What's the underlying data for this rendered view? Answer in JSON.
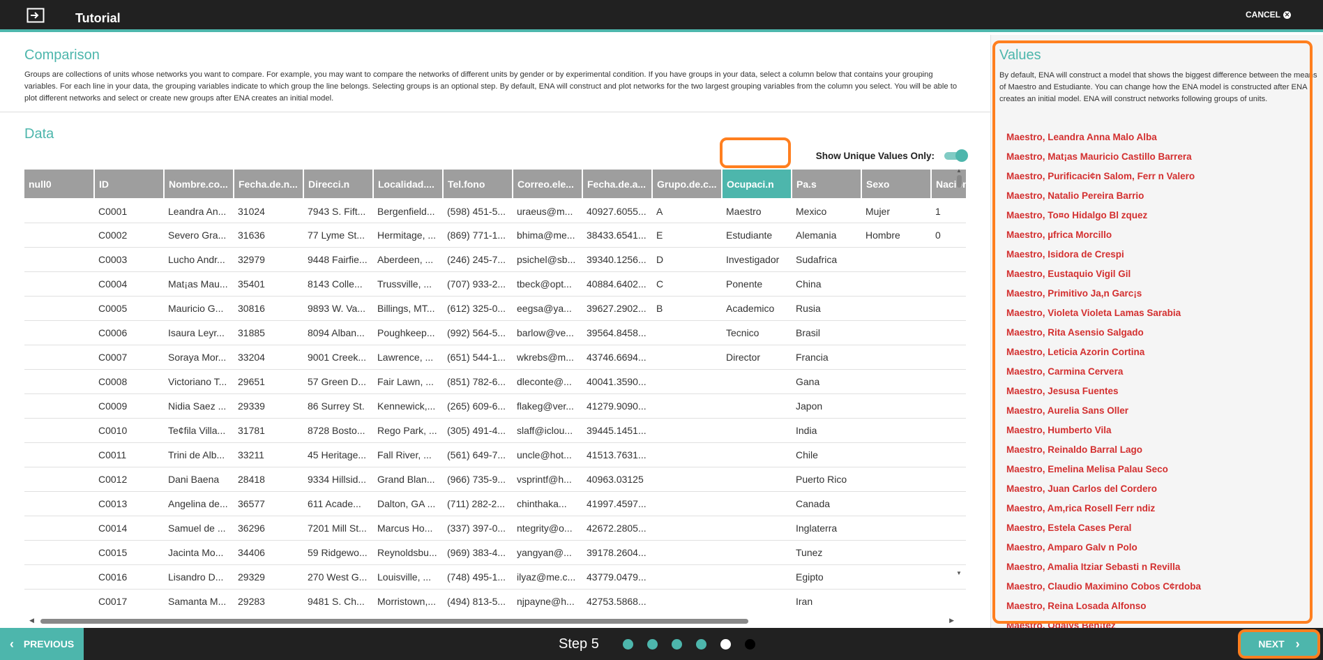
{
  "header": {
    "title": "Tutorial",
    "cancel_label": "CANCEL"
  },
  "comparison": {
    "title": "Comparison",
    "description": "Groups are collections of units whose networks you want to compare. For example, you may want to compare the networks of different units by gender or by experimental condition. If you have groups in your data, select a column below that contains your grouping variables. For each line in your data, the grouping variables indicate to which group the line belongs. Selecting groups is an optional step. By default, ENA will construct and plot networks for the two largest grouping variables from the column you select. You will be able to plot different networks and select or create new groups after ENA creates an initial model."
  },
  "data_section": {
    "title": "Data",
    "unique_toggle_label": "Show Unique Values Only:",
    "unique_toggle_on": true
  },
  "table": {
    "columns": [
      "null0",
      "ID",
      "Nombre.co...",
      "Fecha.de.n...",
      "Direcci.n",
      "Localidad....",
      "Tel.fono",
      "Correo.ele...",
      "Fecha.de.a...",
      "Grupo.de.c...",
      "Ocupaci.n",
      "Pa.s",
      "Sexo",
      "Nacion"
    ],
    "highlighted_column": "Ocupaci.n",
    "rows": [
      [
        "",
        "C0001",
        "Leandra An...",
        "31024",
        "7943 S. Fift...",
        "Bergenfield...",
        "(598) 451-5...",
        "uraeus@m...",
        "40927.6055...",
        "A",
        "Maestro",
        "Mexico",
        "Mujer",
        "1"
      ],
      [
        "",
        "C0002",
        "Severo Gra...",
        "31636",
        "77 Lyme St...",
        "Hermitage, ...",
        "(869) 771-1...",
        "bhima@me...",
        "38433.6541...",
        "E",
        "Estudiante",
        "Alemania",
        "Hombre",
        "0"
      ],
      [
        "",
        "C0003",
        "Lucho Andr...",
        "32979",
        "9448 Fairfie...",
        "Aberdeen, ...",
        "(246) 245-7...",
        "psichel@sb...",
        "39340.1256...",
        "D",
        "Investigador",
        "Sudafrica",
        "",
        ""
      ],
      [
        "",
        "C0004",
        "Mat¡as Mau...",
        "35401",
        "8143 Colle...",
        "Trussville, ...",
        "(707) 933-2...",
        "tbeck@opt...",
        "40884.6402...",
        "C",
        "Ponente",
        "China",
        "",
        ""
      ],
      [
        "",
        "C0005",
        "Mauricio G...",
        "30816",
        "9893 W. Va...",
        "Billings, MT...",
        "(612) 325-0...",
        "eegsa@ya...",
        "39627.2902...",
        "B",
        "Academico",
        "Rusia",
        "",
        ""
      ],
      [
        "",
        "C0006",
        "Isaura Leyr...",
        "31885",
        "8094 Alban...",
        "Poughkeep...",
        "(992) 564-5...",
        "barlow@ve...",
        "39564.8458...",
        "",
        "Tecnico",
        "Brasil",
        "",
        ""
      ],
      [
        "",
        "C0007",
        "Soraya Mor...",
        "33204",
        "9001 Creek...",
        "Lawrence, ...",
        "(651) 544-1...",
        "wkrebs@m...",
        "43746.6694...",
        "",
        "Director",
        "Francia",
        "",
        ""
      ],
      [
        "",
        "C0008",
        "Victoriano T...",
        "29651",
        "57 Green D...",
        "Fair Lawn, ...",
        "(851) 782-6...",
        "dleconte@...",
        "40041.3590...",
        "",
        "",
        "Gana",
        "",
        ""
      ],
      [
        "",
        "C0009",
        "Nidia Saez ...",
        "29339",
        "86 Surrey St.",
        "Kennewick,...",
        "(265) 609-6...",
        "flakeg@ver...",
        "41279.9090...",
        "",
        "",
        "Japon",
        "",
        ""
      ],
      [
        "",
        "C0010",
        "Te¢fila Villa...",
        "31781",
        "8728 Bosto...",
        "Rego Park, ...",
        "(305) 491-4...",
        "slaff@iclou...",
        "39445.1451...",
        "",
        "",
        "India",
        "",
        ""
      ],
      [
        "",
        "C0011",
        "Trini de Alb...",
        "33211",
        "45 Heritage...",
        "Fall River, ...",
        "(561) 649-7...",
        "uncle@hot...",
        "41513.7631...",
        "",
        "",
        "Chile",
        "",
        ""
      ],
      [
        "",
        "C0012",
        "Dani Baena",
        "28418",
        "9334 Hillsid...",
        "Grand Blan...",
        "(966) 735-9...",
        "vsprintf@h...",
        "40963.03125",
        "",
        "",
        "Puerto Rico",
        "",
        ""
      ],
      [
        "",
        "C0013",
        "Angelina de...",
        "36577",
        "611 Acade...",
        "Dalton, GA ...",
        "(711) 282-2...",
        "chinthaka...",
        "41997.4597...",
        "",
        "",
        "Canada",
        "",
        ""
      ],
      [
        "",
        "C0014",
        "Samuel de ...",
        "36296",
        "7201 Mill St...",
        "Marcus Ho...",
        "(337) 397-0...",
        "ntegrity@o...",
        "42672.2805...",
        "",
        "",
        "Inglaterra",
        "",
        ""
      ],
      [
        "",
        "C0015",
        "Jacinta Mo...",
        "34406",
        "59 Ridgewo...",
        "Reynoldsbu...",
        "(969) 383-4...",
        "yangyan@...",
        "39178.2604...",
        "",
        "",
        "Tunez",
        "",
        ""
      ],
      [
        "",
        "C0016",
        "Lisandro D...",
        "29329",
        "270 West G...",
        "Louisville, ...",
        "(748) 495-1...",
        "ilyaz@me.c...",
        "43779.0479...",
        "",
        "",
        "Egipto",
        "",
        ""
      ],
      [
        "",
        "C0017",
        "Samanta M...",
        "29283",
        "9481 S. Ch...",
        "Morristown,...",
        "(494) 813-5...",
        "njpayne@h...",
        "42753.5868...",
        "",
        "",
        "Iran",
        "",
        ""
      ]
    ]
  },
  "values_panel": {
    "title": "Values",
    "description": "By default, ENA will construct a model that shows the biggest difference between the means of Maestro and Estudiante. You can change how the ENA model is constructed after ENA creates an initial model. ENA will construct networks following groups of units.",
    "items": [
      "Maestro, Leandra Anna Malo Alba",
      "Maestro, Mat¡as Mauricio Castillo Barrera",
      "Maestro, Purificaci¢n Salom, Ferr n Valero",
      "Maestro, Natalio Pereira Barrio",
      "Maestro, To¤o Hidalgo Bl zquez",
      "Maestro, µfrica Morcillo",
      "Maestro, Isidora de Crespi",
      "Maestro, Eustaquio Vigil Gil",
      "Maestro, Primitivo Ja,n Garc¡s",
      "Maestro, Violeta Violeta Lamas Sarabia",
      "Maestro, Rita Asensio Salgado",
      "Maestro, Leticia Azorin Cortina",
      "Maestro, Carmina Cervera",
      "Maestro, Jesusa Fuentes",
      "Maestro, Aurelia Sans Oller",
      "Maestro, Humberto Vila",
      "Maestro, Reinaldo Barral Lago",
      "Maestro, Emelina Melisa Palau Seco",
      "Maestro, Juan Carlos del Cordero",
      "Maestro, Am,rica Rosell Ferr ndiz",
      "Maestro, Estela Cases Peral",
      "Maestro, Amparo Galv n Polo",
      "Maestro, Amalia Itziar Sebasti n Revilla",
      "Maestro, Claudio Maximino Cobos C¢rdoba",
      "Maestro, Reina Losada Alfonso",
      "Maestro, Odalys Ben¡tez"
    ]
  },
  "footer": {
    "previous_label": "PREVIOUS",
    "step_label": "Step 5",
    "next_label": "NEXT",
    "total_steps": 6,
    "current_step": 5
  },
  "colors": {
    "accent": "#4db6ac",
    "highlight": "#ff7f1f",
    "value_text": "#d32f2f",
    "bar": "#212121"
  }
}
